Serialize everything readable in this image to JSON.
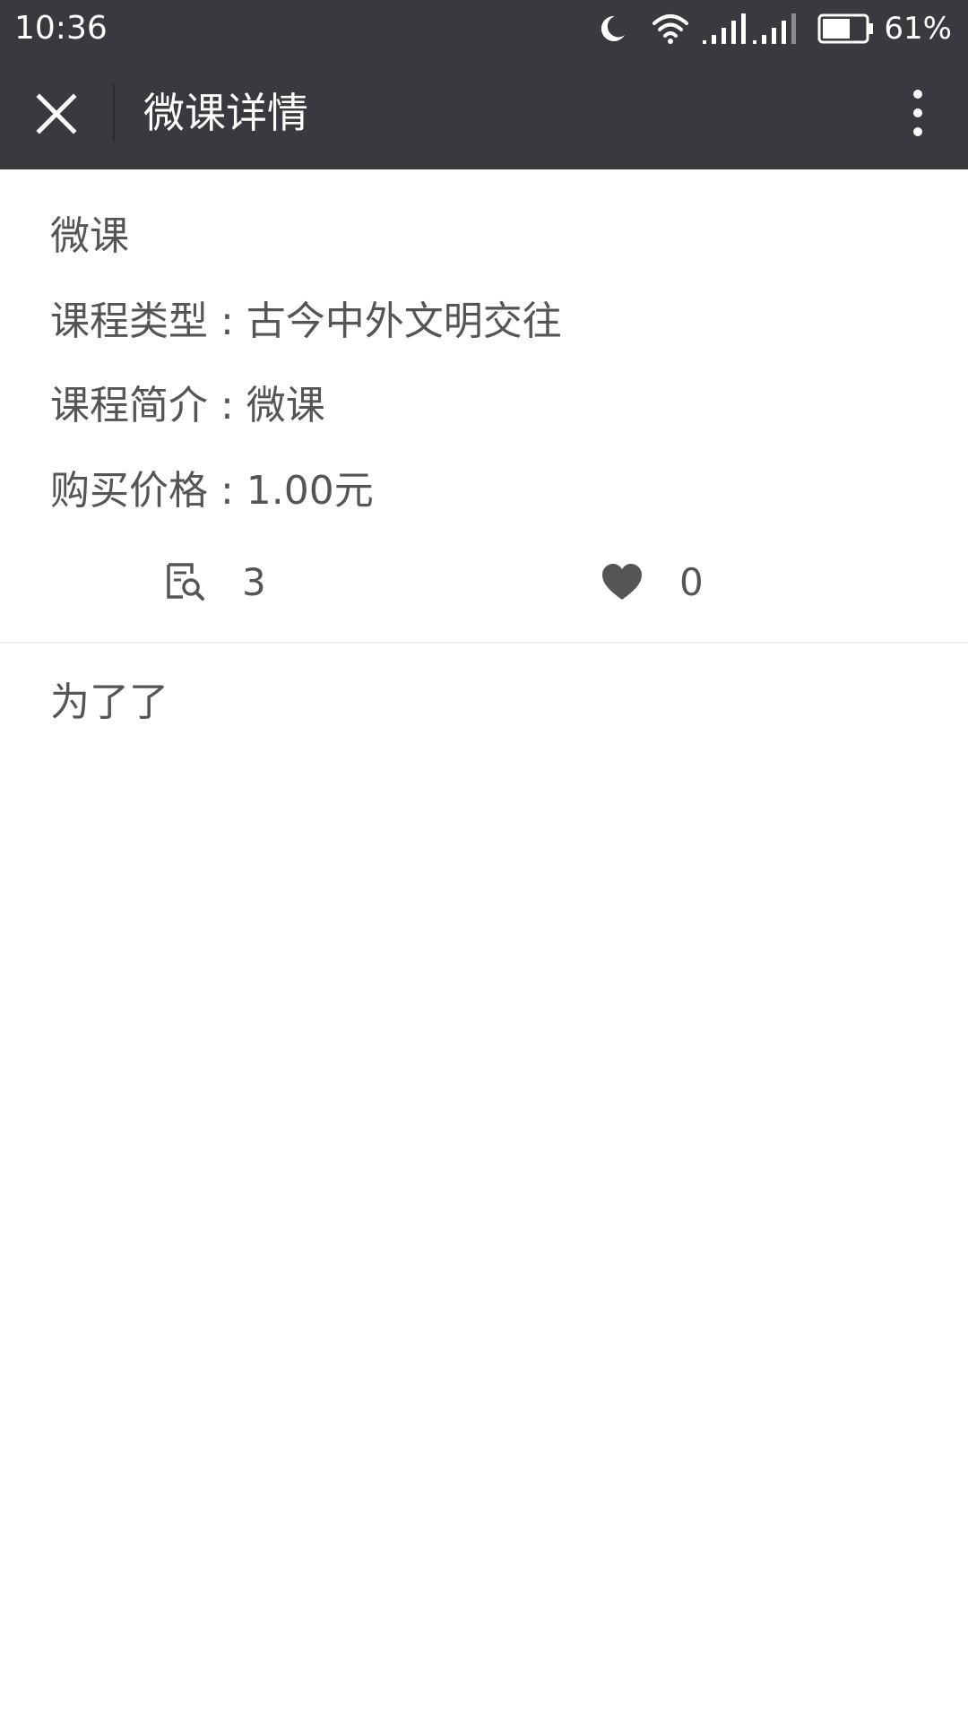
{
  "status_bar": {
    "time": "10:36",
    "battery": "61%",
    "icons": [
      "moon-icon",
      "wifi-icon",
      "signal-icon",
      "signal-icon",
      "battery-icon"
    ]
  },
  "header": {
    "title": "微课详情",
    "close_icon": "close-icon",
    "more_icon": "more-vertical-icon"
  },
  "course": {
    "name": "微课",
    "type_label": "课程类型 : 古今中外文明交往",
    "intro_label": "课程简介 : 微课",
    "price_label": "购买价格 : 1.00元",
    "views": "3",
    "likes": "0"
  },
  "body": {
    "text": "为了了"
  }
}
